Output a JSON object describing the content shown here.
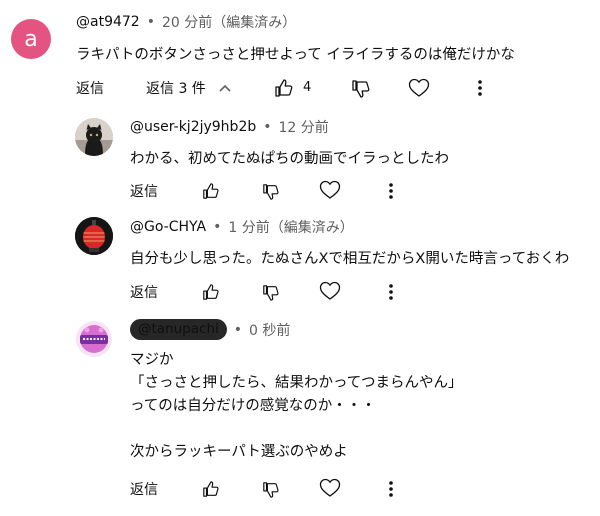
{
  "comments": [
    {
      "avatar_letter": "a",
      "handle": "@at9472",
      "separator": "•",
      "time": "20 分前（編集済み）",
      "text": "ラキパトのボタンさっさと押せよって イライラするのは俺だけかな",
      "reply_label": "返信",
      "replies_label": "返信 3 件",
      "like_count": "4"
    },
    {
      "handle": "@user-kj2jy9hb2b",
      "separator": "•",
      "time": "12 分前",
      "text": "わかる、初めてたぬぱちの動画でイラっとしたわ",
      "reply_label": "返信"
    },
    {
      "handle": "@Go-CHYA",
      "separator": "•",
      "time": "1 分前（編集済み）",
      "text": "自分も少し思った。たぬさんXで相互だからX開いた時言っておくわ",
      "reply_label": "返信"
    },
    {
      "handle": "@tanupachi",
      "separator": "•",
      "time": "0 秒前",
      "lines": [
        "マジか",
        "「さっさと押したら、結果わかってつまらんやん」",
        "ってのは自分だけの感覚なのか・・・",
        "",
        "次からラッキーパト選ぶのやめよ"
      ],
      "reply_label": "返信"
    }
  ],
  "colors": {
    "avatar_a_bg": "#e35480",
    "owner_pill_bg": "#272727",
    "meta_gray": "#606060"
  }
}
